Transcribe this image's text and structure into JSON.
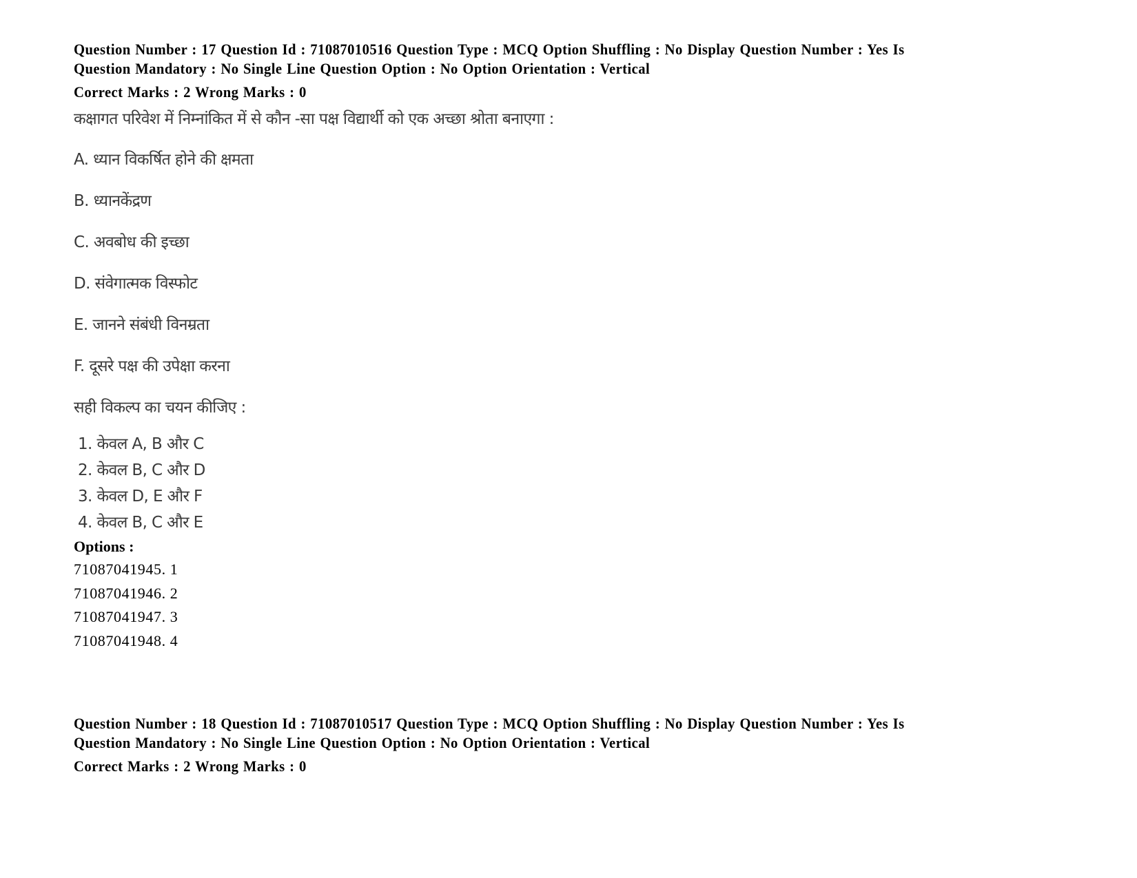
{
  "questions": [
    {
      "meta_line1": "Question Number : 17 Question Id : 71087010516 Question Type : MCQ Option Shuffling : No Display Question Number : Yes Is",
      "meta_line2": "Question Mandatory : No Single Line Question Option : No Option Orientation : Vertical",
      "marks": "Correct Marks : 2 Wrong Marks : 0",
      "stem": "कक्षागत परिवेश में निम्नांकित में से कौन -सा पक्ष विद्यार्थी को एक अच्छा श्रोता बनाएगा :",
      "statements": [
        "A. ध्यान विकर्षित होने की क्षमता",
        "B. ध्यानकेंद्रण",
        "C. अवबोध की इच्छा",
        "D. संवेगात्मक विस्फोट",
        "E. जानने संबंधी विनम्रता",
        "F. दूसरे पक्ष की उपेक्षा करना"
      ],
      "choose_prompt": "सही विकल्प का चयन कीजिए :",
      "choices": [
        "1. केवल A, B और C",
        "2. केवल B, C और D",
        "3. केवल D, E और F",
        "4. केवल B, C और E"
      ],
      "options_label": "Options :",
      "options": [
        "71087041945. 1",
        "71087041946. 2",
        "71087041947. 3",
        "71087041948. 4"
      ]
    },
    {
      "meta_line1": "Question Number : 18 Question Id : 71087010517 Question Type : MCQ Option Shuffling : No Display Question Number : Yes Is",
      "meta_line2": "Question Mandatory : No Single Line Question Option : No Option Orientation : Vertical",
      "marks": "Correct Marks : 2 Wrong Marks : 0"
    }
  ]
}
